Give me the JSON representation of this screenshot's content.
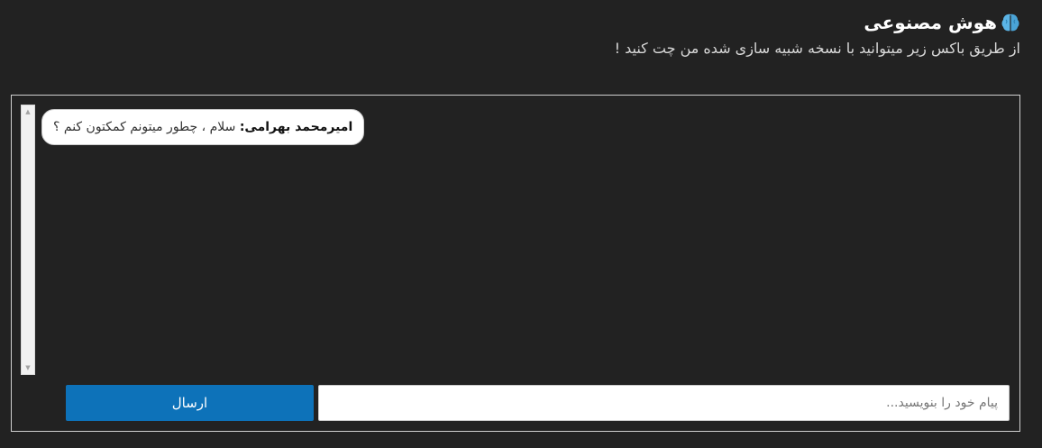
{
  "header": {
    "icon": "brain-icon",
    "title": "هوش مصنوعی",
    "subtitle": "از طریق باکس زیر میتوانید با نسخه شبیه سازی شده من چت کنید !"
  },
  "chat": {
    "messages": [
      {
        "sender": "امیرمحمد بهرامی:",
        "text": " سلام ، چطور میتونم کمکتون کنم ؟"
      }
    ]
  },
  "input": {
    "placeholder": "پیام خود را بنویسید...",
    "value": ""
  },
  "send_button": {
    "label": "ارسال"
  },
  "colors": {
    "background": "#222222",
    "accent": "#0d72b9",
    "icon": "#5bb4e5"
  }
}
